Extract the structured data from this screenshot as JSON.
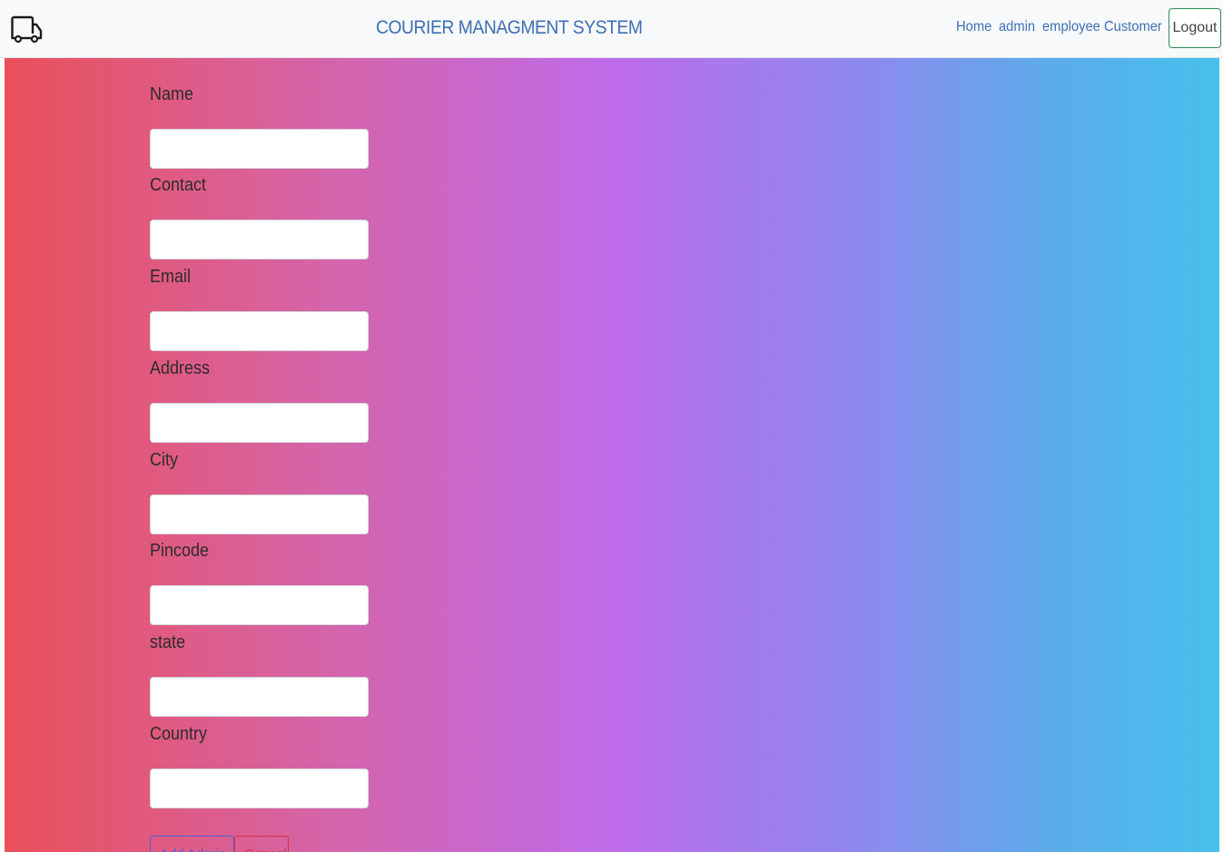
{
  "header": {
    "logo_icon": "truck-icon",
    "title": "COURIER MANAGMENT SYSTEM",
    "nav": [
      {
        "label": "Home"
      },
      {
        "label": "admin"
      },
      {
        "label": "employee"
      },
      {
        "label": "Customer"
      }
    ],
    "logout_label": "Logout"
  },
  "form": {
    "fields": [
      {
        "label": "Name",
        "value": ""
      },
      {
        "label": "Contact",
        "value": ""
      },
      {
        "label": "Email",
        "value": ""
      },
      {
        "label": "Address",
        "value": ""
      },
      {
        "label": "City",
        "value": ""
      },
      {
        "label": "Pincode",
        "value": ""
      },
      {
        "label": "state",
        "value": ""
      },
      {
        "label": "Country",
        "value": ""
      }
    ],
    "add_label": "Add Admin",
    "cancel_label": "Cancel"
  },
  "colors": {
    "gradient": [
      "#ea5059",
      "#be6bea",
      "#45c0ec"
    ],
    "link": "#3d6fb6",
    "logout_border": "#2e8b57",
    "add_button": "#4a5fd6",
    "cancel_button": "#d8323f"
  }
}
